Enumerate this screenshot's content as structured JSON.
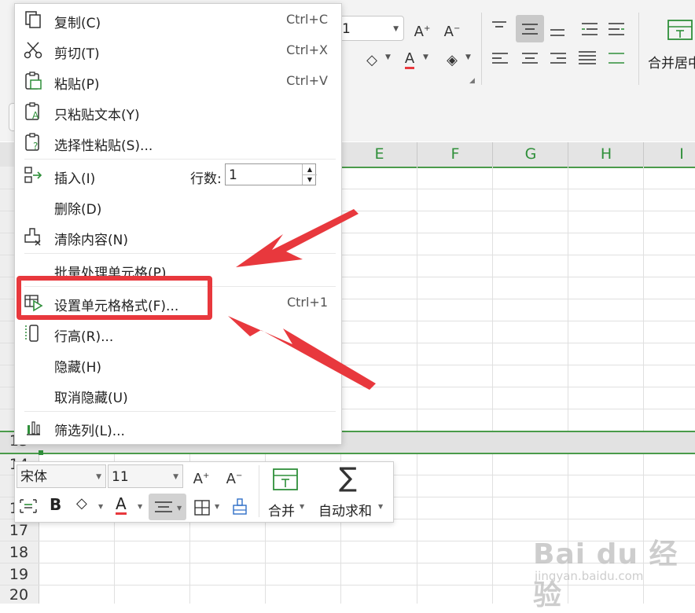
{
  "ribbon": {
    "font_size_value": "1",
    "merge_label": "合并居中"
  },
  "columns": [
    "E",
    "F",
    "G",
    "H",
    "I"
  ],
  "rows": [
    "13",
    "14",
    "16",
    "17",
    "18",
    "19",
    "20"
  ],
  "context_menu": {
    "items": [
      {
        "label": "复制(C)",
        "shortcut": "Ctrl+C",
        "icon": "copy-icon"
      },
      {
        "label": "剪切(T)",
        "shortcut": "Ctrl+X",
        "icon": "scissors-icon"
      },
      {
        "label": "粘贴(P)",
        "shortcut": "Ctrl+V",
        "icon": "paste-icon"
      },
      {
        "label": "只粘贴文本(Y)",
        "shortcut": "",
        "icon": "paste-text-icon"
      },
      {
        "label": "选择性粘贴(S)...",
        "shortcut": "",
        "icon": "paste-special-icon"
      },
      {
        "label": "插入(I)",
        "shortcut": "",
        "icon": "insert-icon"
      },
      {
        "label": "删除(D)",
        "shortcut": "",
        "icon": ""
      },
      {
        "label": "清除内容(N)",
        "shortcut": "",
        "icon": "eraser-icon"
      },
      {
        "label": "批量处理单元格(P)",
        "shortcut": "",
        "icon": ""
      },
      {
        "label": "设置单元格格式(F)...",
        "shortcut": "Ctrl+1",
        "icon": "format-cells-icon"
      },
      {
        "label": "行高(R)...",
        "shortcut": "",
        "icon": "row-height-icon"
      },
      {
        "label": "隐藏(H)",
        "shortcut": "",
        "icon": ""
      },
      {
        "label": "取消隐藏(U)",
        "shortcut": "",
        "icon": ""
      },
      {
        "label": "筛选列(L)...",
        "shortcut": "",
        "icon": "filter-columns-icon"
      }
    ],
    "rows_label": "行数:",
    "rows_value": "1"
  },
  "mini_toolbar": {
    "font_name": "宋体",
    "font_size": "11",
    "merge_label": "合并",
    "autosum_label": "自动求和"
  },
  "watermark": {
    "main": "Bai du 经验",
    "sub": "jingyan.baidu.com"
  },
  "colors": {
    "accent_green": "#2f8f3a",
    "highlight_red": "#e8383d"
  }
}
